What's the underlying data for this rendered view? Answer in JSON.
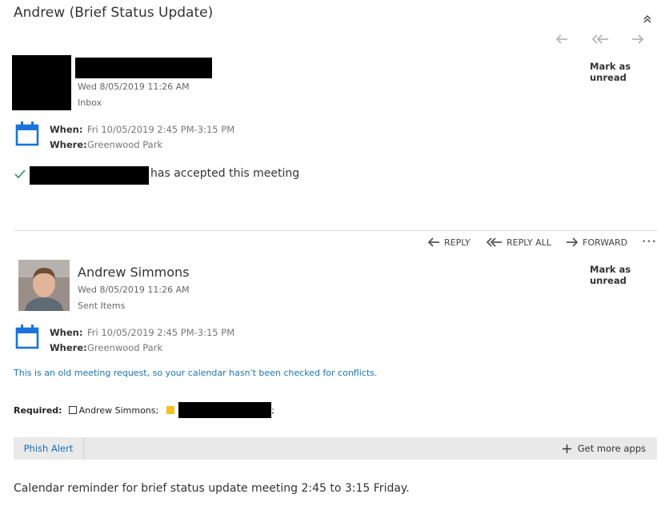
{
  "thread": {
    "title": "Andrew (Brief Status Update)"
  },
  "message1": {
    "date": "Wed 8/05/2019 11:26 AM",
    "folder": "Inbox",
    "mark_unread": "Mark as unread",
    "when_label": "When:",
    "when_value": "Fri 10/05/2019 2:45 PM-3:15 PM",
    "where_label": "Where:",
    "where_value": "Greenwood Park",
    "accepted_text": "has accepted this meeting"
  },
  "actions": {
    "reply": "REPLY",
    "reply_all": "REPLY ALL",
    "forward": "FORWARD",
    "more": "•••"
  },
  "message2": {
    "sender": "Andrew Simmons",
    "date": "Wed 8/05/2019 11:26 AM",
    "folder": "Sent Items",
    "mark_unread": "Mark as unread",
    "when_label": "When:",
    "when_value": "Fri 10/05/2019 2:45 PM-3:15 PM",
    "where_label": "Where:",
    "where_value": "Greenwood Park",
    "conflict_note": "This is an old meeting request, so your calendar hasn't been checked for conflicts.",
    "required_label": "Required:",
    "attendee1": "Andrew Simmons;",
    "attendee2_suffix": ";",
    "body": "Calendar reminder for brief status update meeting 2:45 to 3:15 Friday."
  },
  "addins": {
    "phish_alert": "Phish Alert",
    "get_more_apps": "Get more apps"
  },
  "colors": {
    "accent_blue": "#1a6fb5",
    "calendar_blue": "#1a73d9",
    "accepted_green": "#3a9a6e",
    "attendee_yellow": "#f3c31c"
  }
}
